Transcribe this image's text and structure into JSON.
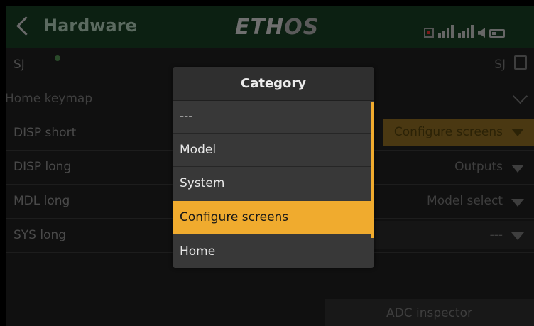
{
  "header": {
    "title": "Hardware",
    "logo_left": "ETH",
    "logo_right": "OS"
  },
  "rows": {
    "sj": {
      "label": "SJ",
      "value": "SJ"
    },
    "home_keymap": {
      "label": "Home keymap"
    },
    "disp_short": {
      "label": "DISP short",
      "value": "Configure screens"
    },
    "disp_long": {
      "label": "DISP long",
      "value": "Outputs"
    },
    "mdl_long": {
      "label": "MDL long",
      "value": "Model select"
    },
    "sys_long": {
      "label": "SYS long",
      "value": "---"
    },
    "adc_inspector": {
      "label": "ADC inspector"
    }
  },
  "modal": {
    "title": "Category",
    "options": [
      "---",
      "Model",
      "System",
      "Configure screens",
      "Home"
    ],
    "selected": "Configure screens"
  },
  "colors": {
    "accent": "#f0ab2e",
    "modal_bg": "#383838",
    "header_bg": "#0c2012"
  }
}
